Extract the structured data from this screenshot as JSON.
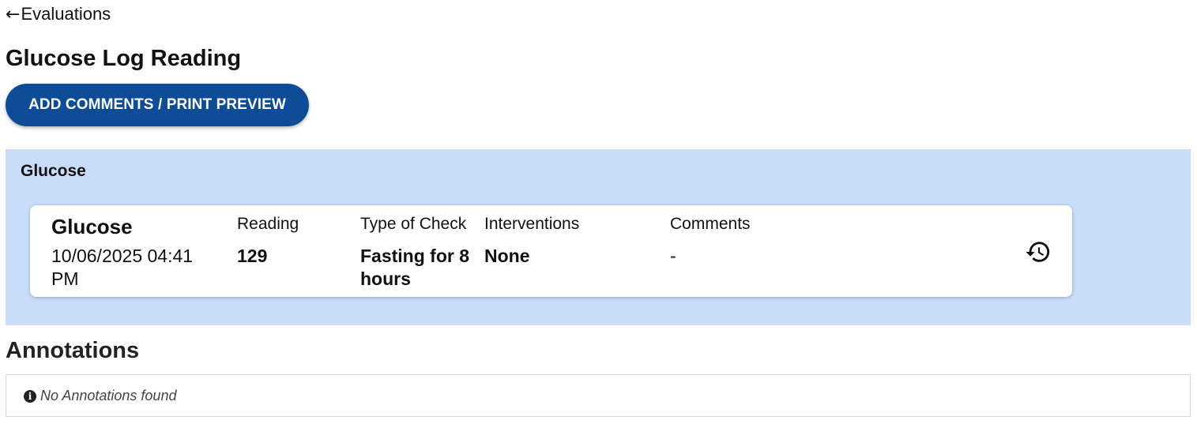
{
  "nav": {
    "back_arrow": "←",
    "back_label": "Evaluations"
  },
  "page": {
    "title": "Glucose Log Reading"
  },
  "actions": {
    "primary_label": "ADD COMMENTS / PRINT PREVIEW"
  },
  "section": {
    "title": "Glucose",
    "background": "#c9ddfb"
  },
  "reading": {
    "name": "Glucose",
    "datetime": "10/06/2025 04:41 PM",
    "columns": [
      {
        "label": "Reading",
        "value": "129"
      },
      {
        "label": "Type of Check",
        "value": "Fasting for 8 hours"
      },
      {
        "label": "Interventions",
        "value": "None"
      },
      {
        "label": "Comments",
        "value": "-"
      }
    ],
    "history_icon": "history-icon"
  },
  "annotations": {
    "title": "Annotations",
    "info_icon": "i",
    "empty_message": "No Annotations found"
  },
  "colors": {
    "primary": "#0f4c97",
    "panel": "#c9ddfb"
  }
}
